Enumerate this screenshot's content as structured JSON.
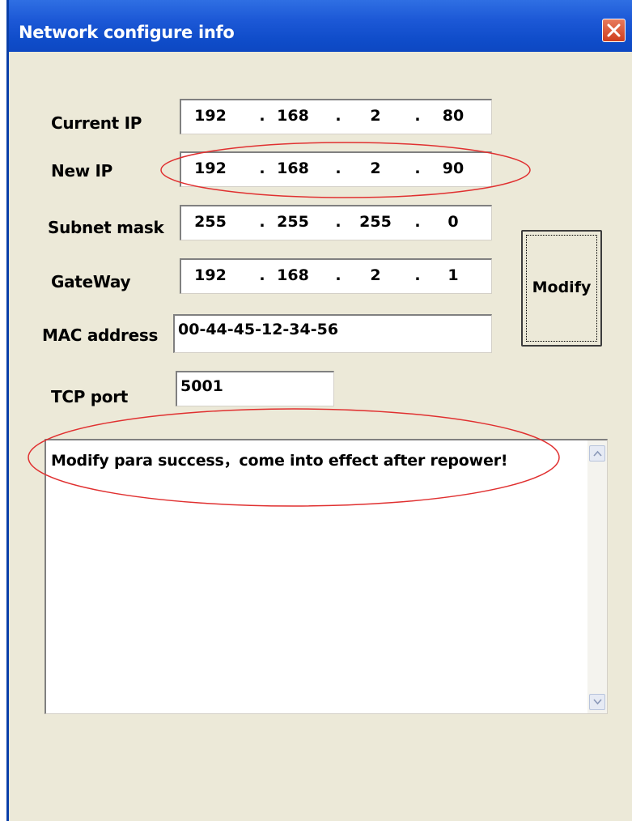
{
  "window": {
    "title": "Network configure info"
  },
  "form": {
    "current_ip": {
      "label": "Current IP",
      "octets": [
        "192",
        "168",
        "2",
        "80"
      ]
    },
    "new_ip": {
      "label": "New IP",
      "octets": [
        "192",
        "168",
        "2",
        "90"
      ]
    },
    "subnet_mask": {
      "label": "Subnet mask",
      "octets": [
        "255",
        "255",
        "255",
        "0"
      ]
    },
    "gateway": {
      "label": "GateWay",
      "octets": [
        "192",
        "168",
        "2",
        "1"
      ]
    },
    "mac_address": {
      "label": "MAC address",
      "value": "00-44-45-12-34-56"
    },
    "tcp_port": {
      "label": "TCP port",
      "value": "5001"
    },
    "ip_separator": "."
  },
  "buttons": {
    "modify": "Modify"
  },
  "output": {
    "message": "Modify para success，come into effect after repower!"
  },
  "icons": {
    "close": "close-icon",
    "scroll_up": "scroll-up-arrow-icon",
    "scroll_down": "scroll-down-arrow-icon"
  },
  "colors": {
    "titlebar": "#0b41b8",
    "dialog_bg": "#ece9d8",
    "highlight_annotation": "#e03030",
    "close_button": "#cf3e1e"
  }
}
